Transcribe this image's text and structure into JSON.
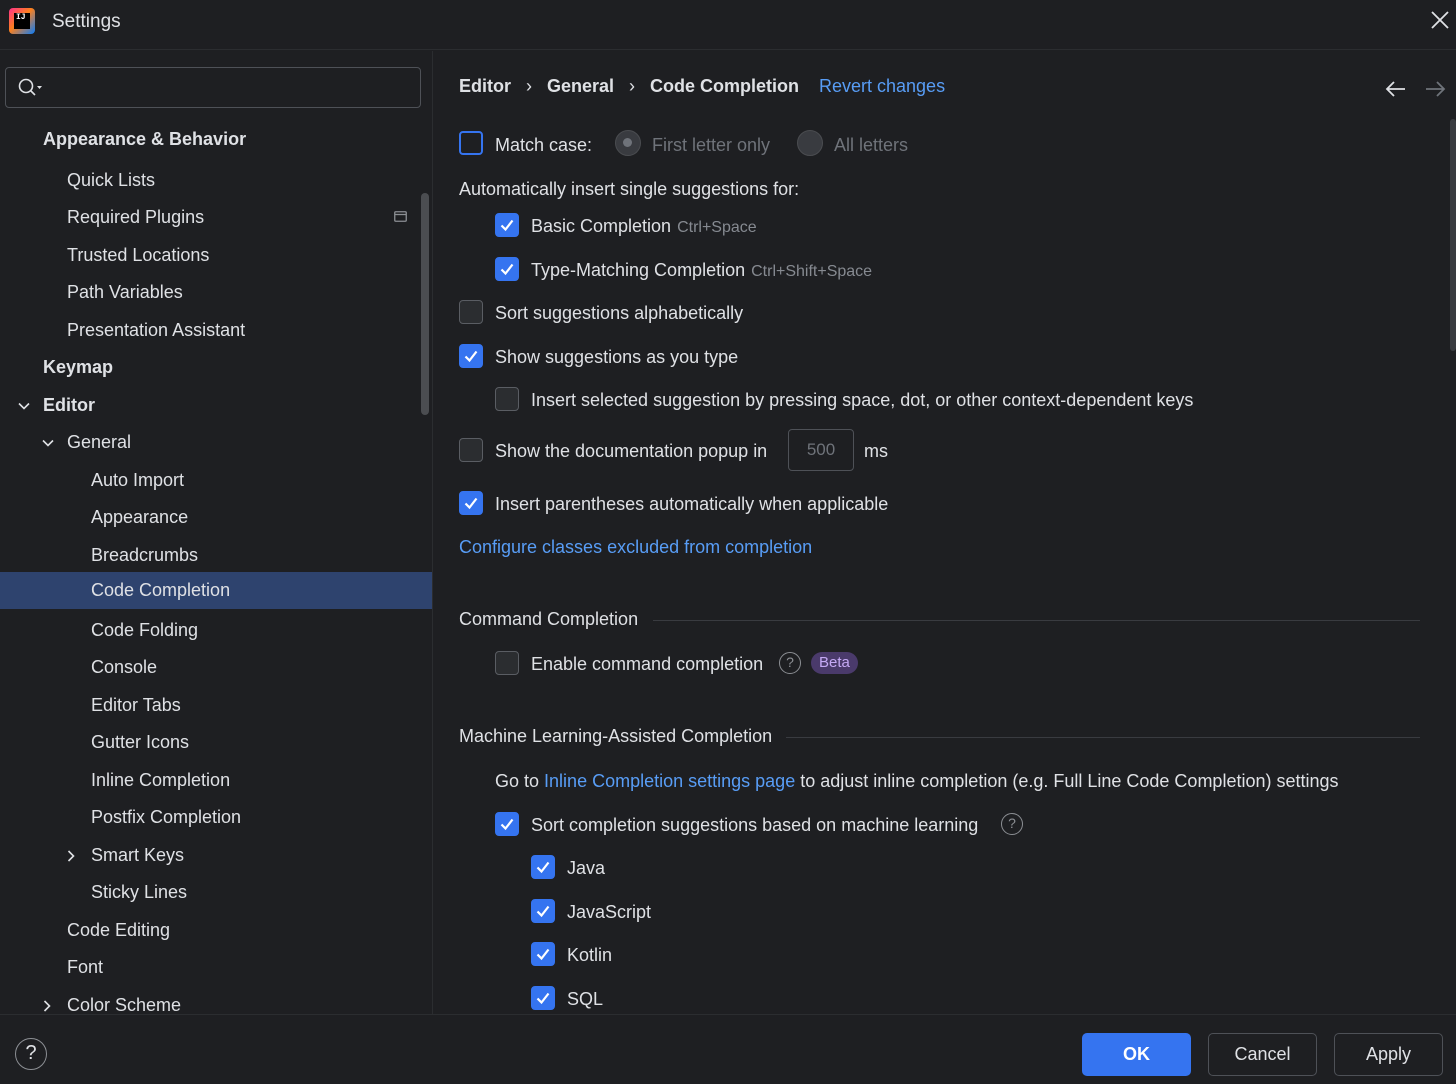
{
  "window": {
    "title": "Settings"
  },
  "sidebar": {
    "search_placeholder": "",
    "items": [
      {
        "label": "Appearance & Behavior"
      },
      {
        "label": "Quick Lists"
      },
      {
        "label": "Required Plugins"
      },
      {
        "label": "Trusted Locations"
      },
      {
        "label": "Path Variables"
      },
      {
        "label": "Presentation Assistant"
      },
      {
        "label": "Keymap"
      },
      {
        "label": "Editor"
      },
      {
        "label": "General"
      },
      {
        "label": "Auto Import"
      },
      {
        "label": "Appearance"
      },
      {
        "label": "Breadcrumbs"
      },
      {
        "label": "Code Completion"
      },
      {
        "label": "Code Folding"
      },
      {
        "label": "Console"
      },
      {
        "label": "Editor Tabs"
      },
      {
        "label": "Gutter Icons"
      },
      {
        "label": "Inline Completion"
      },
      {
        "label": "Postfix Completion"
      },
      {
        "label": "Smart Keys"
      },
      {
        "label": "Sticky Lines"
      },
      {
        "label": "Code Editing"
      },
      {
        "label": "Font"
      },
      {
        "label": "Color Scheme"
      }
    ],
    "selected": "Code Completion"
  },
  "breadcrumb": {
    "items": [
      "Editor",
      "General",
      "Code Completion"
    ],
    "revert": "Revert changes"
  },
  "settings": {
    "match_case": {
      "label": "Match case:",
      "checked": false,
      "opt1": "First letter only",
      "opt2": "All letters",
      "selected": "First letter only"
    },
    "auto_insert_header": "Automatically insert single suggestions for:",
    "basic": {
      "label": "Basic Completion",
      "shortcut": "Ctrl+Space",
      "checked": true
    },
    "type_matching": {
      "label": "Type-Matching Completion",
      "shortcut": "Ctrl+Shift+Space",
      "checked": true
    },
    "sort_alpha": {
      "label": "Sort suggestions alphabetically",
      "checked": false
    },
    "show_as_type": {
      "label": "Show suggestions as you type",
      "checked": true
    },
    "insert_selected": {
      "label": "Insert selected suggestion by pressing space, dot, or other context-dependent keys",
      "checked": false
    },
    "doc_popup": {
      "label": "Show the documentation popup in",
      "value": "500",
      "unit": "ms",
      "checked": false
    },
    "parentheses": {
      "label": "Insert parentheses automatically when applicable",
      "checked": true
    },
    "configure_link": "Configure classes excluded from completion",
    "command_section": "Command Completion",
    "enable_command": {
      "label": "Enable command completion",
      "checked": false,
      "badge": "Beta"
    },
    "ml_section": "Machine Learning-Assisted Completion",
    "ml_goto_prefix": "Go to",
    "ml_goto_link": "Inline Completion settings page",
    "ml_goto_suffix": "to adjust inline completion (e.g. Full Line Code Completion) settings",
    "ml_sort": {
      "label": "Sort completion suggestions based on machine learning",
      "checked": true
    },
    "ml_languages": [
      {
        "label": "Java",
        "checked": true
      },
      {
        "label": "JavaScript",
        "checked": true
      },
      {
        "label": "Kotlin",
        "checked": true
      },
      {
        "label": "SQL",
        "checked": true
      }
    ]
  },
  "footer": {
    "help": "?",
    "ok": "OK",
    "cancel": "Cancel",
    "apply": "Apply"
  },
  "colors": {
    "accent": "#3574f0",
    "link": "#589df6",
    "background": "#1e1f22",
    "selection": "#2e436e"
  }
}
